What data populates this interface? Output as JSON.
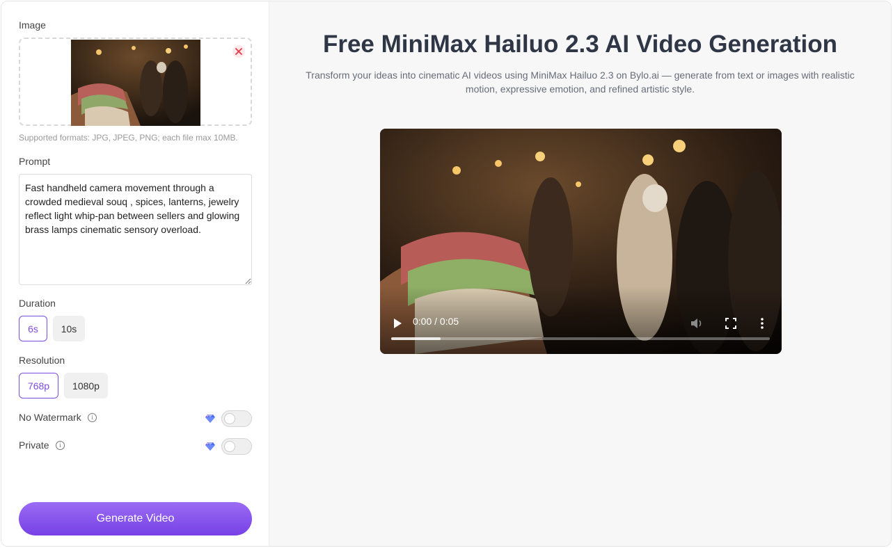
{
  "sidebar": {
    "image_label": "Image",
    "upload_hint": "Supported formats: JPG, JPEG, PNG; each file max 10MB.",
    "prompt_label": "Prompt",
    "prompt_value": "Fast handheld camera movement through a crowded medieval souq , spices, lanterns, jewelry reflect light whip-pan between sellers and glowing brass lamps cinematic sensory overload.",
    "duration_label": "Duration",
    "duration_options": [
      "6s",
      "10s"
    ],
    "duration_selected": "6s",
    "resolution_label": "Resolution",
    "resolution_options": [
      "768p",
      "1080p"
    ],
    "resolution_selected": "768p",
    "no_watermark_label": "No Watermark",
    "private_label": "Private",
    "generate_label": "Generate Video"
  },
  "main": {
    "title": "Free MiniMax Hailuo 2.3 AI Video Generation",
    "subtitle": "Transform your ideas into cinematic AI videos using MiniMax Hailuo 2.3 on Bylo.ai — generate from text or images with realistic motion, expressive emotion, and refined artistic style.",
    "video_time": "0:00 / 0:05",
    "video_progress": 0.13
  },
  "colors": {
    "accent": "#7c4ddc",
    "remove": "#e0394a",
    "gem": "#4f6cf0"
  },
  "icons": {
    "remove": "close-icon",
    "info": "info-icon",
    "premium": "diamond-icon",
    "play": "play-icon",
    "volume": "volume-icon",
    "fullscreen": "fullscreen-icon",
    "more": "more-vertical-icon"
  }
}
